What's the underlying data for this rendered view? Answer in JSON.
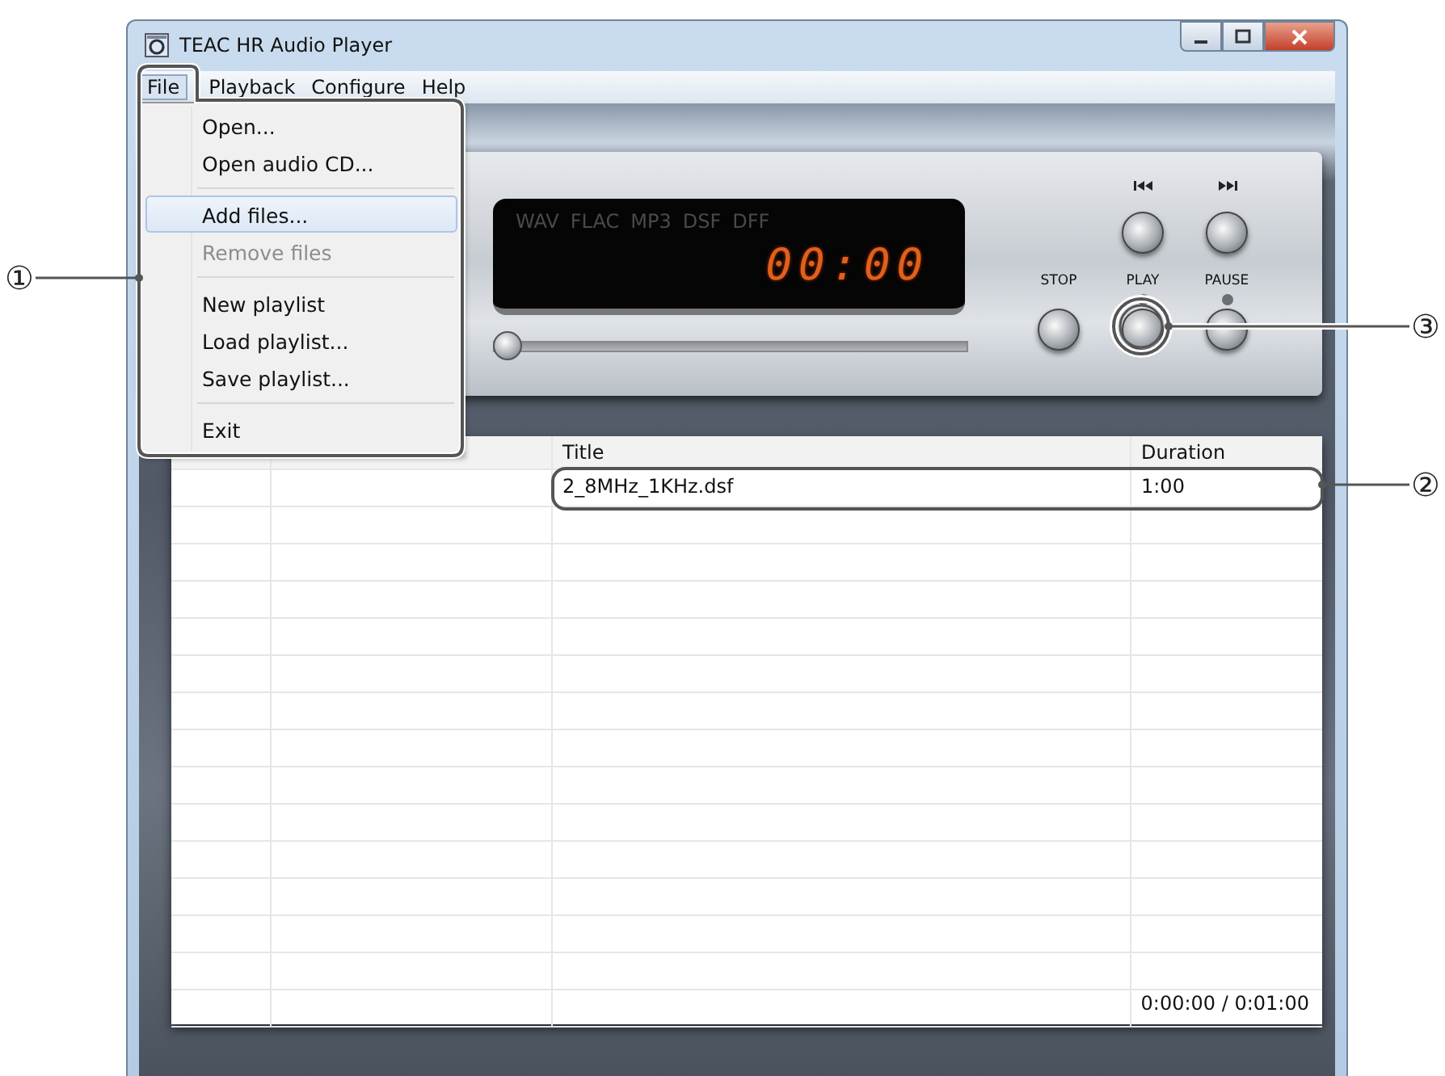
{
  "window": {
    "title": "TEAC HR Audio Player"
  },
  "menubar": [
    {
      "label": "File",
      "selected": true
    },
    {
      "label": "Playback",
      "selected": false
    },
    {
      "label": "Configure",
      "selected": false
    },
    {
      "label": "Help",
      "selected": false
    }
  ],
  "file_menu": [
    {
      "kind": "item",
      "label": "Open...",
      "disabled": false,
      "selected": false
    },
    {
      "kind": "item",
      "label": "Open audio CD...",
      "disabled": false,
      "selected": false
    },
    {
      "kind": "separator"
    },
    {
      "kind": "item",
      "label": "Add files...",
      "disabled": false,
      "selected": true
    },
    {
      "kind": "item",
      "label": "Remove files",
      "disabled": true,
      "selected": false
    },
    {
      "kind": "separator"
    },
    {
      "kind": "item",
      "label": "New playlist",
      "disabled": false,
      "selected": false
    },
    {
      "kind": "item",
      "label": "Load playlist...",
      "disabled": false,
      "selected": false
    },
    {
      "kind": "item",
      "label": "Save playlist...",
      "disabled": false,
      "selected": false
    },
    {
      "kind": "separator"
    },
    {
      "kind": "item",
      "label": "Exit",
      "disabled": false,
      "selected": false
    }
  ],
  "display": {
    "formats": [
      "WAV",
      "FLAC",
      "MP3",
      "DSF",
      "DFF"
    ],
    "time": "00:00"
  },
  "seek": {
    "level": 0
  },
  "transport": [
    {
      "kind": "prev"
    },
    {
      "kind": "next"
    },
    {
      "kind": "stop",
      "label": "STOP"
    },
    {
      "kind": "play",
      "label": "PLAY"
    },
    {
      "kind": "pause",
      "label": "PAUSE"
    }
  ],
  "playlist": {
    "columns": [
      "Title",
      "Duration"
    ],
    "rows": [
      {
        "title": "2_8MHz_1KHz.dsf",
        "duration": "1:00"
      }
    ],
    "total_time": "0:00:00 / 0:01:00"
  },
  "callouts": [
    {
      "number": "①",
      "kind": "menu"
    },
    {
      "number": "②",
      "kind": "row"
    },
    {
      "number": "③",
      "kind": "play"
    }
  ]
}
